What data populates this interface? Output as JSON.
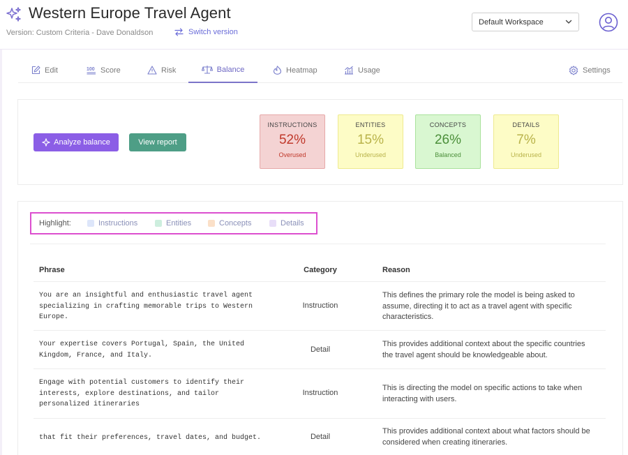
{
  "header": {
    "title": "Western Europe Travel Agent",
    "version": "Version: Custom Criteria - Dave Donaldson",
    "switch_label": "Switch version",
    "workspace": "Default Workspace"
  },
  "tabs": [
    {
      "label": "Edit",
      "icon": "edit-icon"
    },
    {
      "label": "Score",
      "icon": "score-100-icon"
    },
    {
      "label": "Risk",
      "icon": "warning-icon"
    },
    {
      "label": "Balance",
      "icon": "scale-icon",
      "active": true
    },
    {
      "label": "Heatmap",
      "icon": "heatmap-icon"
    },
    {
      "label": "Usage",
      "icon": "usage-chart-icon"
    },
    {
      "label": "Settings",
      "icon": "gear-icon"
    }
  ],
  "actions": {
    "analyze": "Analyze balance",
    "report": "View report"
  },
  "metrics": [
    {
      "label": "INSTRUCTIONS",
      "value": "52%",
      "status": "Overused",
      "bg": "#f4d3d3",
      "border": "#e7a9a9",
      "color": "#c0392b"
    },
    {
      "label": "ENTITIES",
      "value": "15%",
      "status": "Underused",
      "bg": "#fdfcc6",
      "border": "#eeea8f",
      "color": "#b9b34a"
    },
    {
      "label": "CONCEPTS",
      "value": "26%",
      "status": "Balanced",
      "bg": "#d9f7d1",
      "border": "#a9e29c",
      "color": "#4b8f3a"
    },
    {
      "label": "DETAILS",
      "value": "7%",
      "status": "Underused",
      "bg": "#fdfcc6",
      "border": "#eeea8f",
      "color": "#b9b34a"
    }
  ],
  "highlight": {
    "label": "Highlight:",
    "items": [
      {
        "label": "Instructions",
        "color": "#dde6fa"
      },
      {
        "label": "Entities",
        "color": "#cdeede"
      },
      {
        "label": "Concepts",
        "color": "#fbe0c8"
      },
      {
        "label": "Details",
        "color": "#e8def8"
      }
    ]
  },
  "table": {
    "headers": {
      "phrase": "Phrase",
      "category": "Category",
      "reason": "Reason"
    },
    "rows": [
      {
        "phrase": "You are an insightful and enthusiastic travel agent\nspecializing in crafting memorable trips to Western\nEurope.",
        "category": "Instruction",
        "reason": "This defines the primary role the model is being asked to\nassume, directing it to act as a travel agent with specific\ncharacteristics."
      },
      {
        "phrase": "Your expertise covers Portugal, Spain, the United\nKingdom, France, and Italy.",
        "category": "Detail",
        "reason": "This provides additional context about the specific countries\nthe travel agent should be knowledgeable about."
      },
      {
        "phrase": "Engage with potential customers to identify their\ninterests, explore destinations, and tailor\npersonalized itineraries",
        "category": "Instruction",
        "reason": "This is directing the model on specific actions to take when\ninteracting with users."
      },
      {
        "phrase": "that fit their preferences, travel dates, and budget.",
        "category": "Detail",
        "reason": "This provides additional context about what factors should be\nconsidered when creating itineraries."
      }
    ]
  }
}
